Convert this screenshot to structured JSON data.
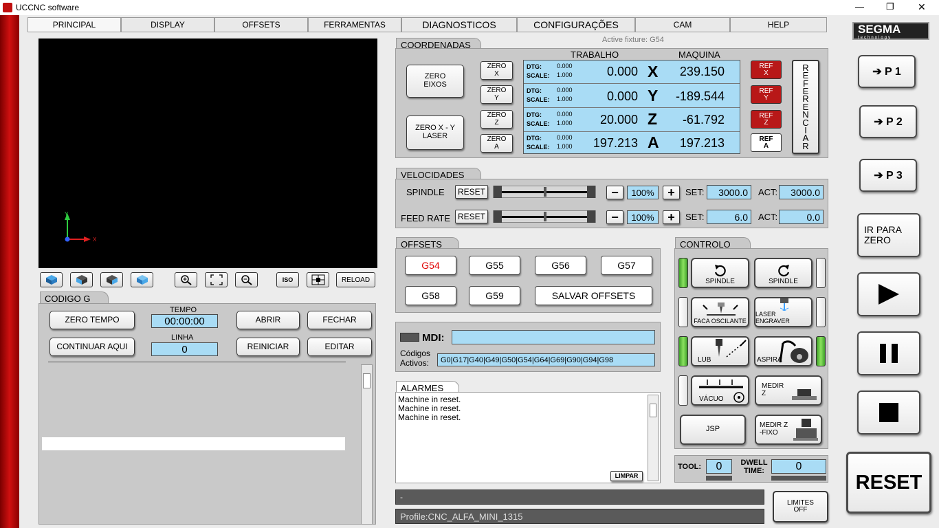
{
  "window": {
    "title": "UCCNC software",
    "min": "—",
    "max": "❐",
    "close": "✕"
  },
  "tabs": [
    "PRINCIPAL",
    "DISPLAY",
    "OFFSETS",
    "FERRAMENTAS",
    "DIAGNOSTICOS",
    "CONFIGURAÇÕES",
    "CAM",
    "HELP"
  ],
  "logo": {
    "text": "SEGMA",
    "sub": "technology"
  },
  "side": {
    "p1": "➔ P 1",
    "p2": "➔ P 2",
    "p3": "➔ P 3",
    "ir": "IR PARA ZERO",
    "reset": "RESET"
  },
  "viewer": {
    "toolbar": {
      "iso": "ISO",
      "reload": "RELOAD"
    }
  },
  "coord": {
    "tab": "COORDENADAS",
    "fixture": "Active fixture: G54",
    "zero_eixos": "ZERO EIXOS",
    "zero_laser": "ZERO X - Y LASER",
    "trabalho": "TRABALHO",
    "maquina": "MAQUINA",
    "referenciar": "REFERENCIAR",
    "axes": [
      {
        "zero": "ZERO X",
        "dtg": "0.000",
        "scale": "1.000",
        "work": "0.000",
        "letter": "X",
        "mach": "239.150",
        "ref": "REF X"
      },
      {
        "zero": "ZERO Y",
        "dtg": "0.000",
        "scale": "1.000",
        "work": "0.000",
        "letter": "Y",
        "mach": "-189.544",
        "ref": "REF Y"
      },
      {
        "zero": "ZERO Z",
        "dtg": "0.000",
        "scale": "1.000",
        "work": "20.000",
        "letter": "Z",
        "mach": "-61.792",
        "ref": "REF Z"
      },
      {
        "zero": "ZERO A",
        "dtg": "0.000",
        "scale": "1.000",
        "work": "197.213",
        "letter": "A",
        "mach": "197.213",
        "ref": "REF A"
      }
    ],
    "dtg_label": "DTG:",
    "scale_label": "SCALE:"
  },
  "vel": {
    "tab": "VELOCIDADES",
    "spindle": "SPINDLE",
    "feed": "FEED RATE",
    "reset": "RESET",
    "pct1": "100%",
    "pct2": "100%",
    "set": "SET:",
    "act": "ACT:",
    "s_set": "3000.0",
    "s_act": "3000.0",
    "f_set": "6.0",
    "f_act": "0.0",
    "minus": "−",
    "plus": "+",
    "spindle_level": 0.5,
    "feed_level": 0.5
  },
  "offsets": {
    "tab": "OFFSETS",
    "g54": "G54",
    "g55": "G55",
    "g56": "G56",
    "g57": "G57",
    "g58": "G58",
    "g59": "G59",
    "save": "SALVAR OFFSETS"
  },
  "mdi": {
    "label": "MDI:",
    "codes_label": "Códigos Activos:",
    "codes": "G0|G17|G40|G49|G50|G54|G64|G69|G90|G94|G98"
  },
  "alarms": {
    "tab": "ALARMES",
    "lines": [
      "Machine in reset.",
      "Machine in reset.",
      "Machine in reset."
    ],
    "clear": "LIMPAR"
  },
  "controlo": {
    "tab": "CONTROLO",
    "spindle_cw": "SPINDLE",
    "spindle_ccw": "SPINDLE",
    "faca": "FACA OSCILANTE",
    "laser": "LASER ENGRAVER",
    "lub": "LUB",
    "aspira": "ASPIRA",
    "vacuo": "VÁCUO",
    "medir_z": "MEDIR Z",
    "jsp": "JSP",
    "medir_fixo": "MEDIR Z -FIXO"
  },
  "tool": {
    "label": "TOOL:",
    "value": "0",
    "dwell": "DWELL TIME:",
    "dwell_value": "0"
  },
  "status": {
    "line1": "-",
    "profile": "Profile:CNC_ALFA_MINI_1315",
    "limites": "LIMITES OFF"
  },
  "gcode": {
    "tab": "CODIGO G",
    "zero_tempo": "ZERO TEMPO",
    "tempo_label": "TEMPO",
    "tempo": "00:00:00",
    "abrir": "ABRIR",
    "fechar": "FECHAR",
    "continuar": "CONTINUAR AQUI",
    "linha_label": "LINHA",
    "linha": "0",
    "reiniciar": "REINICIAR",
    "editar": "EDITAR"
  }
}
